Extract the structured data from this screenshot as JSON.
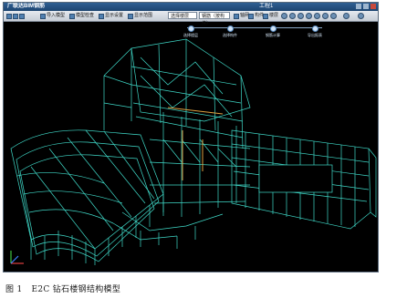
{
  "window": {
    "app_title": "广联达BIM钢筋",
    "project_title": "工程1",
    "controls": [
      "minimize-icon",
      "maximize-icon",
      "close-icon"
    ]
  },
  "toolbar": {
    "file_buttons": [
      "new-icon",
      "open-icon",
      "save-icon"
    ],
    "actions": [
      "导入模型",
      "模型检查",
      "显示设置",
      "显示范围"
    ],
    "view_combo": "选择楼层",
    "layer_combo": "钢筋（按构件）",
    "view_buttons": [
      "轴网",
      "构件",
      "楼层"
    ],
    "tool_icons": [
      "rotate-icon",
      "pan-icon",
      "zoom-icon",
      "fit-icon",
      "section-icon",
      "measure-icon",
      "layers-icon",
      "settings-icon",
      "help-icon"
    ]
  },
  "workflow": {
    "steps": [
      "选择楼层",
      "选择构件",
      "钢筋计算",
      "导出报表"
    ]
  },
  "viewport": {
    "background": "#000000",
    "wire_color": "#3fd9c8",
    "accent_color": "#e0a040"
  },
  "caption": {
    "number": "图 1",
    "text": "E2C 钻石楼钢结构模型"
  }
}
